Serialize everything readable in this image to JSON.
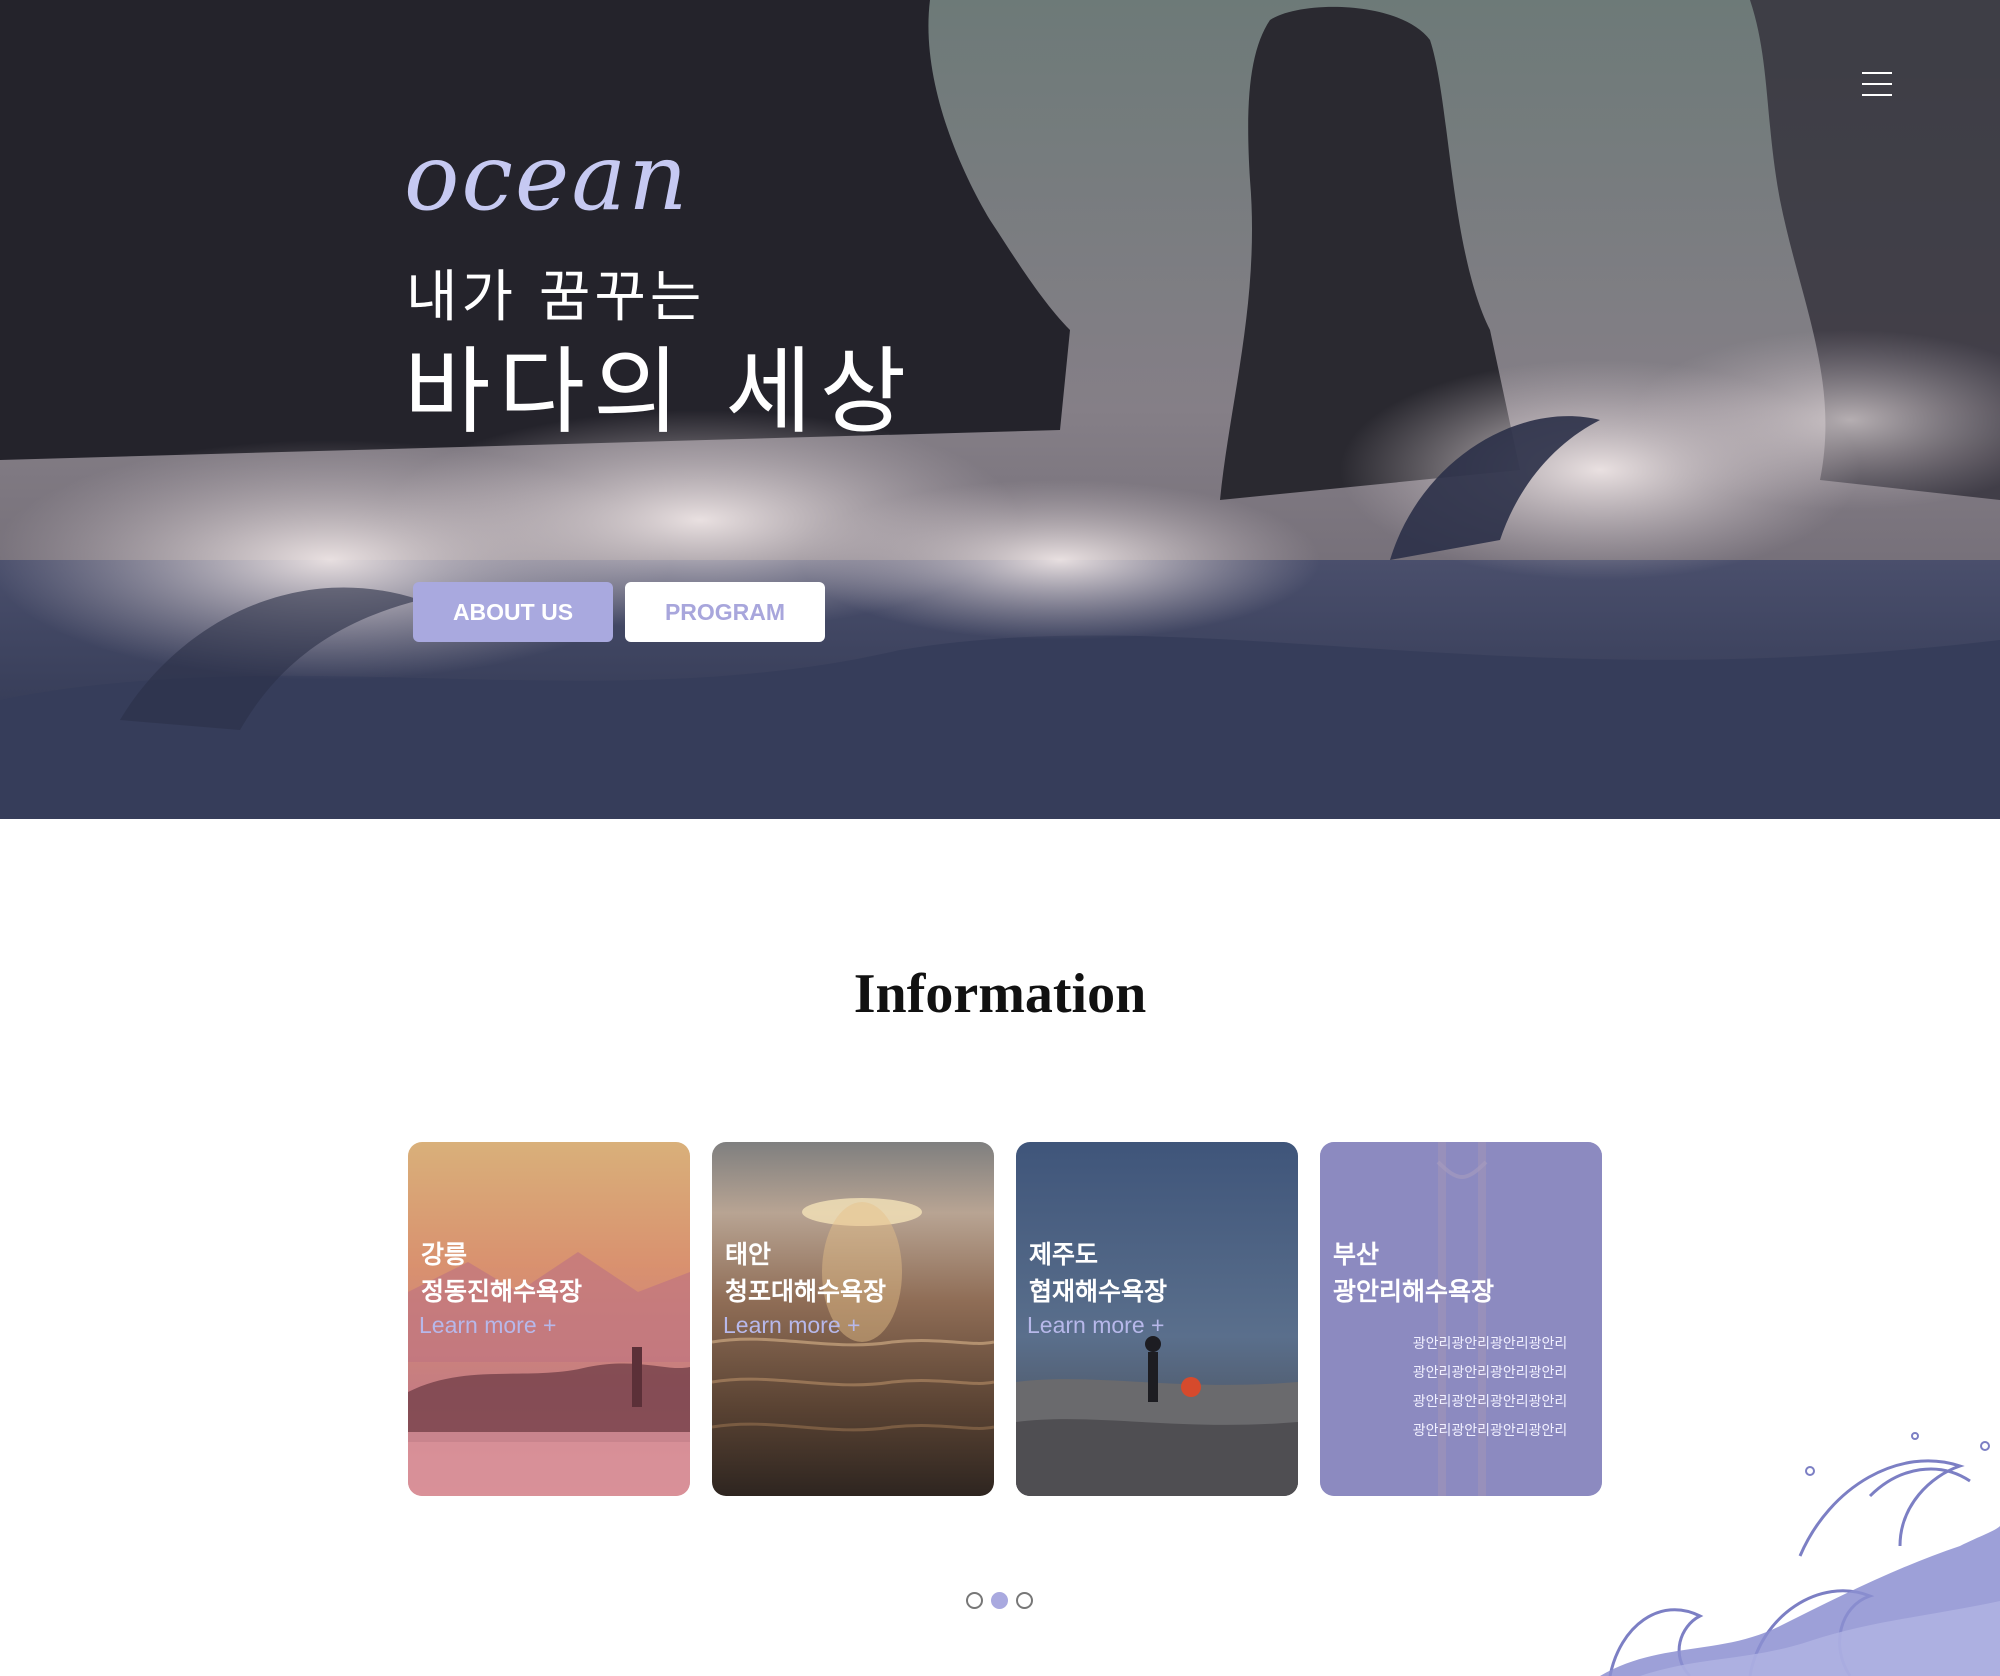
{
  "hero": {
    "logo": "ocean",
    "tagline_small": "내가 꿈꾸는",
    "tagline_big": "바다의 세상",
    "buttons": {
      "about": "ABOUT US",
      "program": "PROGRAM"
    }
  },
  "info": {
    "title": "Information",
    "cards": [
      {
        "title": "강릉\n정동진해수욕장",
        "more": "Learn more +"
      },
      {
        "title": "태안\n청포대해수욕장",
        "more": "Learn more +"
      },
      {
        "title": "제주도\n협재해수욕장",
        "more": "Learn more +"
      },
      {
        "title": "부산\n광안리해수욕장",
        "desc": [
          "광안리광안리광안리광안리",
          "광안리광안리광안리광안리",
          "광안리광안리광안리광안리",
          "광안리광안리광안리광안리"
        ]
      }
    ]
  },
  "pagination": {
    "pages": 3,
    "active": 2
  },
  "colors": {
    "accent": "#a9a9df",
    "accent_text": "#a8a6dc",
    "logo": "#c6c9f2"
  }
}
